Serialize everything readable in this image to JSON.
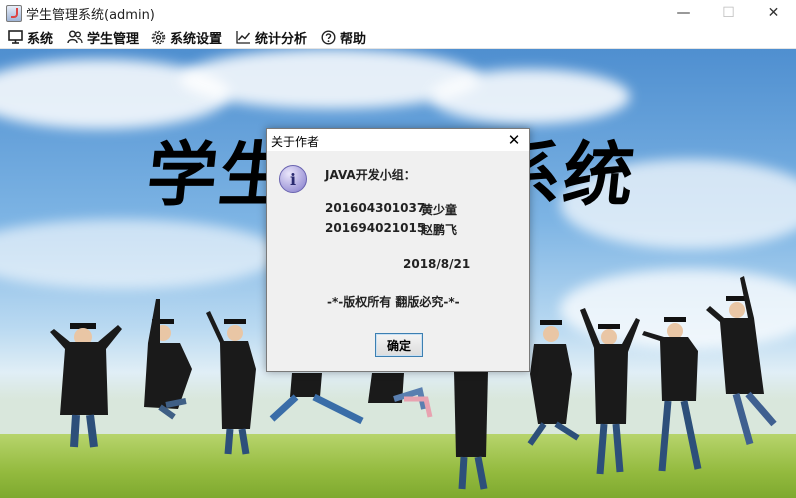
{
  "window": {
    "title": "学生管理系统(admin)",
    "minimize": "—",
    "maximize": "☐",
    "close": "✕"
  },
  "menubar": {
    "items": [
      {
        "label": "系统",
        "icon": "monitor-icon"
      },
      {
        "label": "学生管理",
        "icon": "users-icon"
      },
      {
        "label": "系统设置",
        "icon": "gear-icon"
      },
      {
        "label": "统计分析",
        "icon": "chart-icon"
      },
      {
        "label": "帮助",
        "icon": "help-icon"
      }
    ]
  },
  "background": {
    "banner_left": "学生",
    "banner_right": "系统"
  },
  "dialog": {
    "title": "关于作者",
    "close": "✕",
    "icon": "info-icon",
    "icon_glyph": "i",
    "heading": "JAVA开发小组：",
    "members": [
      {
        "id": "201604301037",
        "name": "黄少童"
      },
      {
        "id": "201694021015",
        "name": "赵鹏飞"
      }
    ],
    "date": "2018/8/21",
    "copyright": "-*-版权所有 翻版必究-*-",
    "ok_label": "确定"
  }
}
